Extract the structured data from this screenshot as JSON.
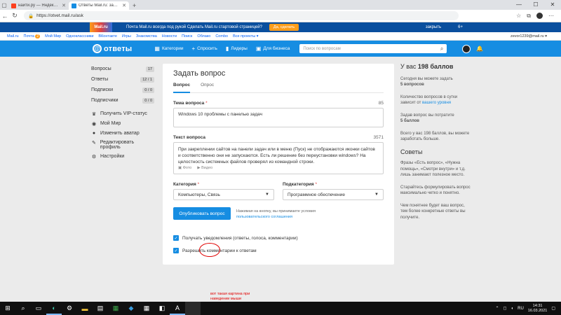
{
  "browser": {
    "tabs": [
      {
        "title": "найти.ру — Яндекс нашлось 12 млн...",
        "color": "#fc3f1d",
        "active": false
      },
      {
        "title": "Ответы Mail.ru: задать вопрос",
        "color": "#168de2",
        "active": true
      }
    ],
    "new_tab": "+",
    "url": "https://otvet.mail.ru/ask",
    "window_controls": [
      "—",
      "☐",
      "✕"
    ]
  },
  "promo": {
    "logo": "Mail.ru",
    "message": "Почта Mail.ru всегда под рукой  Сделать Mail.ru стартовой страницей?",
    "button": "Да, сделать",
    "close": "закрыть",
    "plus": "6+"
  },
  "portal_nav": {
    "items": [
      "Mail.ru",
      "Почта",
      "Мой Мир",
      "Одноклассники",
      "ВКонтакте",
      "Игры",
      "Знакомства",
      "Новости",
      "Поиск",
      "Облако",
      "Combo",
      "Все проекты ▾"
    ],
    "mail_badge": "2",
    "user": "zevor1239@mail.ru ▾"
  },
  "header": {
    "brand": "ответы",
    "nav": [
      {
        "icon": "▦",
        "label": "Категории"
      },
      {
        "icon": "+",
        "label": "Спросить"
      },
      {
        "icon": "▮",
        "label": "Лидеры"
      },
      {
        "icon": "▣",
        "label": "Для бизнеса"
      }
    ],
    "search_placeholder": "Поиск по вопросам"
  },
  "sidebar": {
    "stats": [
      {
        "label": "Вопросы",
        "count": "17"
      },
      {
        "label": "Ответы",
        "count": "12 / 1"
      },
      {
        "label": "Подписки",
        "count": "0 / 0"
      },
      {
        "label": "Подписчики",
        "count": "0 / 0"
      }
    ],
    "menu": [
      {
        "icon": "♛",
        "label": "Получить VIP-статус"
      },
      {
        "icon": "◉",
        "label": "Мой Мир"
      },
      {
        "icon": "●",
        "label": "Изменить аватар"
      },
      {
        "icon": "✎",
        "label": "Редактировать профиль"
      },
      {
        "icon": "⚙",
        "label": "Настройки"
      }
    ]
  },
  "form": {
    "title": "Задать вопрос",
    "tabs": [
      "Вопрос",
      "Опрос"
    ],
    "theme_label": "Тема вопроса",
    "theme_limit": "85",
    "theme_value": "Windows 10 проблемы с панелью задач",
    "text_label": "Текст вопроса",
    "text_limit": "3571",
    "text_value": "При закреплении сайтов на панели задач или в меню (Пуск) не отображаются иконки сайтов и соответственно они не запускаются. Есть ли решение без переустановки  windows? На целостность системных файлов проверял из командной строки.",
    "attach_photo": "Фото",
    "attach_video": "Видео",
    "category_label": "Категория",
    "category_value": "Компьютеры, Связь",
    "subcategory_label": "Подкатегория",
    "subcategory_value": "Программное обеспечение",
    "publish": "Опубликовать вопрос",
    "terms_text": "Нажимая на кнопку, вы принимаете условия",
    "terms_link": "пользовательского соглашения",
    "checkbox_notify": "Получать уведомления (ответы, голоса, комментарии)",
    "checkbox_comments": "Разрешить комментарии к ответам"
  },
  "info": {
    "heading_prefix": "У вас",
    "heading_points": "198 баллов",
    "p1_text": "Сегодня вы можете задать",
    "p1_bold": "5 вопросов",
    "p2_text": "Количество вопросов в сутки зависит от",
    "p2_link": "вашего уровня",
    "p3_text": "Задав вопрос вы потратите",
    "p3_bold": "5 баллов",
    "p4": "Всего у вас 198 баллов, вы можете заработать больше.",
    "tips_title": "Советы",
    "tip1": "Фразы «Есть вопрос», «Нужна помощь», «Смотри внутри» и т.д. лишь занимают полезное место.",
    "tip2": "Старайтесь формулировать вопрос максимально четко и понятно.",
    "tip3": "Чем понятнее будет ваш вопрос, тем более конкретные ответы вы получите."
  },
  "annotation": "вот такая картина при наведении мыши",
  "taskbar": {
    "lang": "RU",
    "time": "14:31",
    "date": "16.03.2021"
  }
}
